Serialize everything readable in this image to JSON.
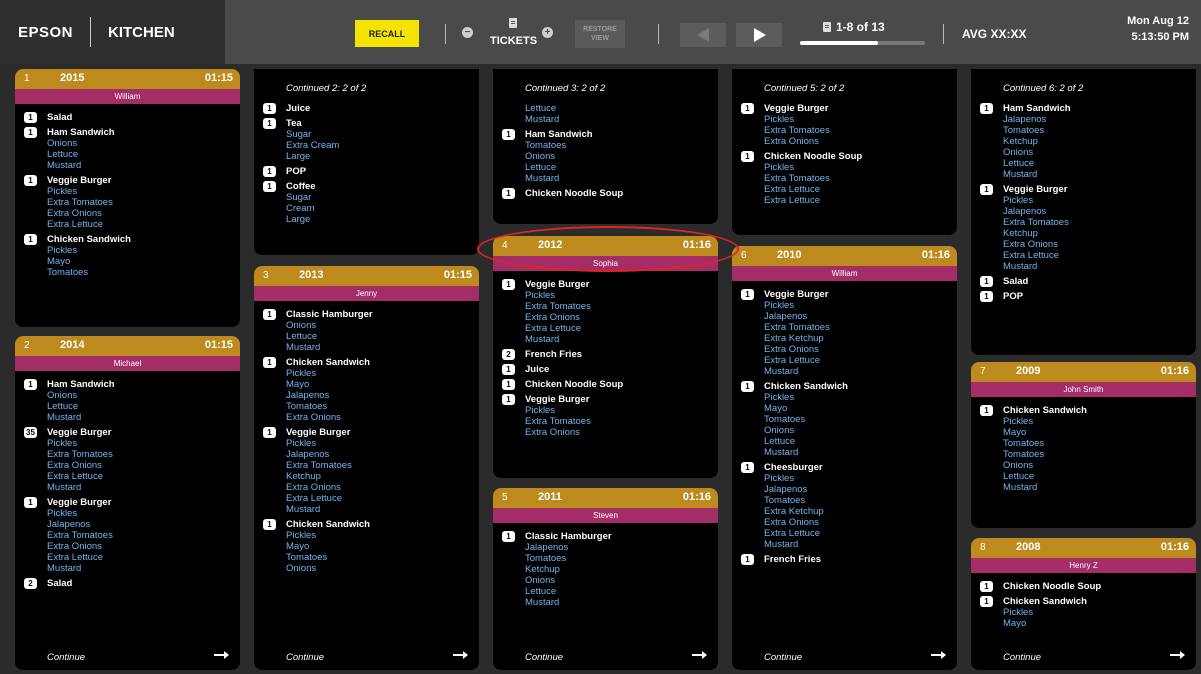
{
  "header": {
    "brand": "EPSON",
    "station": "KITCHEN",
    "recall_label": "RECALL",
    "tickets_label": "TICKETS",
    "minus_icon": "minus-circle-icon",
    "plus_icon": "plus-circle-icon",
    "restore_line1": "RESTORE",
    "restore_line2": "VIEW",
    "pager_text": "1-8 of 13",
    "pager_progress": 0.62,
    "avg_label": "AVG XX:XX",
    "date": "Mon Aug 12",
    "time": "5:13:50 PM"
  },
  "colors": {
    "accent_yellow": "#f5e400",
    "ticket_header": "#bd8a1d",
    "ticket_name": "#a42d68",
    "modifier": "#74b3ef"
  },
  "footer": {
    "continue_label": "Continue"
  },
  "col1": {
    "t1": {
      "num": "1",
      "ticket": "2015",
      "time": "01:15",
      "name": "William",
      "items": [
        {
          "qty": "1",
          "name": "Salad",
          "mods": []
        },
        {
          "qty": "1",
          "name": "Ham Sandwich",
          "mods": [
            "Onions",
            "Lettuce",
            "Mustard"
          ]
        },
        {
          "qty": "1",
          "name": "Veggie Burger",
          "mods": [
            "Pickles",
            "Extra Tomatoes",
            "Extra Onions",
            "Extra Lettuce"
          ]
        },
        {
          "qty": "1",
          "name": "Chicken Sandwich",
          "mods": [
            "Pickles",
            "Mayo",
            "Tomatoes"
          ]
        }
      ]
    },
    "t2": {
      "num": "2",
      "ticket": "2014",
      "time": "01:15",
      "name": "Michael",
      "items": [
        {
          "qty": "1",
          "name": "Ham Sandwich",
          "mods": [
            "Onions",
            "Lettuce",
            "Mustard"
          ]
        },
        {
          "qty": "35",
          "name": "Veggie Burger",
          "mods": [
            "Pickles",
            "Extra Tomatoes",
            "Extra Onions",
            "Extra Lettuce",
            "Mustard"
          ]
        },
        {
          "qty": "1",
          "name": "Veggie Burger",
          "mods": [
            "Pickles",
            "Jalapenos",
            "Extra Tomatoes",
            "Extra Onions",
            "Extra Lettuce",
            "Mustard"
          ]
        },
        {
          "qty": "2",
          "name": "Salad",
          "mods": []
        }
      ]
    }
  },
  "col2": {
    "cont": {
      "label": "Continued 2: 2 of 2",
      "items": [
        {
          "qty": "1",
          "name": "Juice",
          "mods": []
        },
        {
          "qty": "1",
          "name": "Tea",
          "mods": [
            "Sugar",
            "Extra Cream",
            "Large"
          ]
        },
        {
          "qty": "1",
          "name": "POP",
          "mods": []
        },
        {
          "qty": "1",
          "name": "Coffee",
          "mods": [
            "Sugar",
            "Cream",
            "Large"
          ]
        }
      ]
    },
    "t3": {
      "num": "3",
      "ticket": "2013",
      "time": "01:15",
      "name": "Jenny",
      "items": [
        {
          "qty": "1",
          "name": "Classic Hamburger",
          "mods": [
            "Onions",
            "Lettuce",
            "Mustard"
          ]
        },
        {
          "qty": "1",
          "name": "Chicken Sandwich",
          "mods": [
            "Pickles",
            "Mayo",
            "Jalapenos",
            "Tomatoes",
            "Extra Onions"
          ]
        },
        {
          "qty": "1",
          "name": "Veggie Burger",
          "mods": [
            "Pickles",
            "Jalapenos",
            "Extra Tomatoes",
            "Ketchup",
            "Extra Onions",
            "Extra Lettuce",
            "Mustard"
          ]
        },
        {
          "qty": "1",
          "name": "Chicken Sandwich",
          "mods": [
            "Pickles",
            "Mayo",
            "Tomatoes",
            "Onions"
          ]
        }
      ]
    }
  },
  "col3": {
    "cont": {
      "label": "Continued 3: 2 of 2",
      "lead_mods": [
        "Lettuce",
        "Mustard"
      ],
      "items": [
        {
          "qty": "1",
          "name": "Ham Sandwich",
          "mods": [
            "Tomatoes",
            "Onions",
            "Lettuce",
            "Mustard"
          ]
        },
        {
          "qty": "1",
          "name": "Chicken Noodle Soup",
          "mods": []
        }
      ]
    },
    "t4": {
      "num": "4",
      "ticket": "2012",
      "time": "01:16",
      "name": "Sophia",
      "items": [
        {
          "qty": "1",
          "name": "Veggie Burger",
          "mods": [
            "Pickles",
            "Extra Tomatoes",
            "Extra Onions",
            "Extra Lettuce",
            "Mustard"
          ]
        },
        {
          "qty": "2",
          "name": "French Fries",
          "mods": []
        },
        {
          "qty": "1",
          "name": "Juice",
          "mods": []
        },
        {
          "qty": "1",
          "name": "Chicken Noodle Soup",
          "mods": []
        },
        {
          "qty": "1",
          "name": "Veggie Burger",
          "mods": [
            "Pickles",
            "Extra Tomatoes",
            "Extra Onions"
          ]
        }
      ]
    },
    "t5": {
      "num": "5",
      "ticket": "2011",
      "time": "01:16",
      "name": "Steven",
      "items": [
        {
          "qty": "1",
          "name": "Classic Hamburger",
          "mods": [
            "Jalapenos",
            "Tomatoes",
            "Ketchup",
            "Onions",
            "Lettuce",
            "Mustard"
          ]
        }
      ]
    }
  },
  "col4": {
    "cont": {
      "label": "Continued 5: 2 of 2",
      "items": [
        {
          "qty": "1",
          "name": "Veggie Burger",
          "mods": [
            "Pickles",
            "Extra Tomatoes",
            "Extra Onions"
          ]
        },
        {
          "qty": "1",
          "name": "Chicken Noodle Soup",
          "mods": [
            "Pickles",
            "Extra Tomatoes",
            "Extra Lettuce",
            "Extra Lettuce"
          ]
        }
      ]
    },
    "t6": {
      "num": "6",
      "ticket": "2010",
      "time": "01:16",
      "name": "William",
      "items": [
        {
          "qty": "1",
          "name": "Veggie Burger",
          "mods": [
            "Pickles",
            "Jalapenos",
            "Extra Tomatoes",
            "Extra Ketchup",
            "Extra Onions",
            "Extra Lettuce",
            "Mustard"
          ]
        },
        {
          "qty": "1",
          "name": "Chicken Sandwich",
          "mods": [
            "Pickles",
            "Mayo",
            "Tomatoes",
            "Onions",
            "Lettuce",
            "Mustard"
          ]
        },
        {
          "qty": "1",
          "name": "Cheesburger",
          "mods": [
            "Pickles",
            "Jalapenos",
            "Tomatoes",
            "Extra Ketchup",
            "Extra Onions",
            "Extra Lettuce",
            "Mustard"
          ]
        },
        {
          "qty": "1",
          "name": "French Fries",
          "mods": []
        }
      ]
    }
  },
  "col5": {
    "cont": {
      "label": "Continued 6: 2 of 2",
      "items": [
        {
          "qty": "1",
          "name": "Ham Sandwich",
          "mods": [
            "Jalapenos",
            "Tomatoes",
            "Ketchup",
            "Onions",
            "Lettuce",
            "Mustard"
          ]
        },
        {
          "qty": "1",
          "name": "Veggie Burger",
          "mods": [
            "Pickles",
            "Jalapenos",
            "Extra Tomatoes",
            "Ketchup",
            "Extra Onions",
            "Extra Lettuce",
            "Mustard"
          ]
        },
        {
          "qty": "1",
          "name": "Salad",
          "mods": []
        },
        {
          "qty": "1",
          "name": "POP",
          "mods": []
        }
      ]
    },
    "t7": {
      "num": "7",
      "ticket": "2009",
      "time": "01:16",
      "name": "John Smith",
      "items": [
        {
          "qty": "1",
          "name": "Chicken Sandwich",
          "mods": [
            "Pickles",
            "Mayo",
            "Tomatoes",
            "Tomatoes",
            "Onions",
            "Lettuce",
            "Mustard"
          ]
        }
      ]
    },
    "t8": {
      "num": "8",
      "ticket": "2008",
      "time": "01:16",
      "name": "Henry Z",
      "items": [
        {
          "qty": "1",
          "name": "Chicken Noodle Soup",
          "mods": []
        },
        {
          "qty": "1",
          "name": "Chicken Sandwich",
          "mods": [
            "Pickles",
            "Mayo"
          ]
        }
      ]
    }
  }
}
